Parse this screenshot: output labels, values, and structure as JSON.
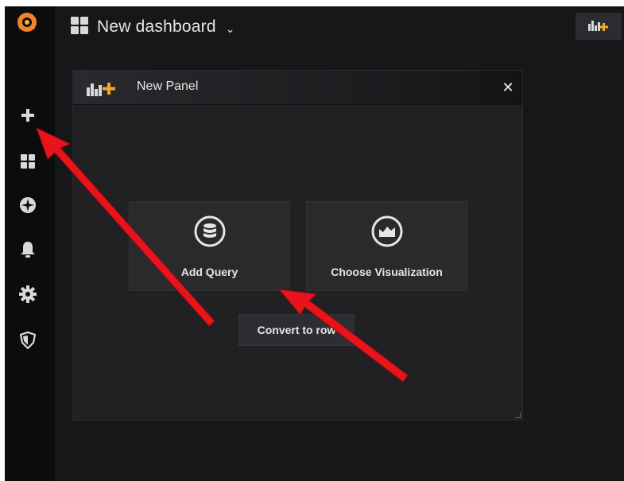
{
  "header": {
    "title": "New dashboard",
    "caret": "⌄",
    "title_icon": "dashboard-grid-icon",
    "add_panel_icon": "add-panel-icon"
  },
  "sidebar": {
    "items": [
      {
        "name": "grafana-logo-icon"
      },
      {
        "name": "plus-icon"
      },
      {
        "name": "dashboards-grid-icon"
      },
      {
        "name": "explore-compass-icon"
      },
      {
        "name": "alerting-bell-icon"
      },
      {
        "name": "configuration-gear-icon"
      },
      {
        "name": "server-admin-shield-icon"
      }
    ]
  },
  "panel": {
    "title": "New Panel",
    "close": "✕",
    "add_query_label": "Add Query",
    "choose_visualization_label": "Choose Visualization",
    "convert_to_row_label": "Convert to row"
  },
  "colors": {
    "background": "#161719",
    "sidebar": "#0b0c0e",
    "panel": "#212124",
    "accent": "#f5a623",
    "annotation_arrow": "#e8141c"
  }
}
